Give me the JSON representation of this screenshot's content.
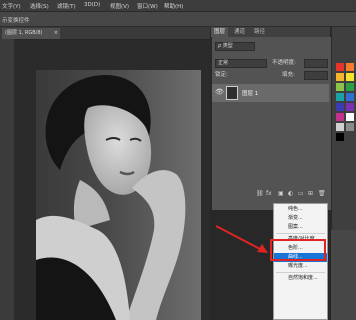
{
  "menubar": {
    "items": [
      "文字(Y)",
      "选择(S)",
      "滤镜(T)",
      "3D(D)",
      "视图(V)",
      "窗口(W)",
      "帮助(H)"
    ]
  },
  "optionsbar": {
    "text": "示变换控件"
  },
  "document": {
    "tab_label": "(图层 1, RGB/8)",
    "close_glyph": "×"
  },
  "panel": {
    "tabs": [
      "图层",
      "通道",
      "路径"
    ],
    "kind_label": "ρ 类型",
    "blend_mode": "正常",
    "opacity_label": "不透明度:",
    "lock_label": "锁定:",
    "fill_label": "填充:",
    "layer_name": "图层 1"
  },
  "adjust_menu": {
    "items": [
      "纯色...",
      "渐变...",
      "图案...",
      "亮度/对比度...",
      "色阶...",
      "曲线...",
      "曝光度...",
      "自然饱和度..."
    ],
    "highlighted_index": 5
  },
  "swatches": [
    "#e8322a",
    "#f57a2b",
    "#f7b52d",
    "#f5e32c",
    "#8bc34a",
    "#2e9e46",
    "#1ba1a6",
    "#2f6fd1",
    "#3a3bb5",
    "#7b2fb3",
    "#c2318d",
    "#ffffff",
    "#d0d0d0",
    "#8a8a8a",
    "#000000"
  ],
  "colors": {
    "highlight": "#1874d6",
    "annotation_red": "#e02424"
  }
}
